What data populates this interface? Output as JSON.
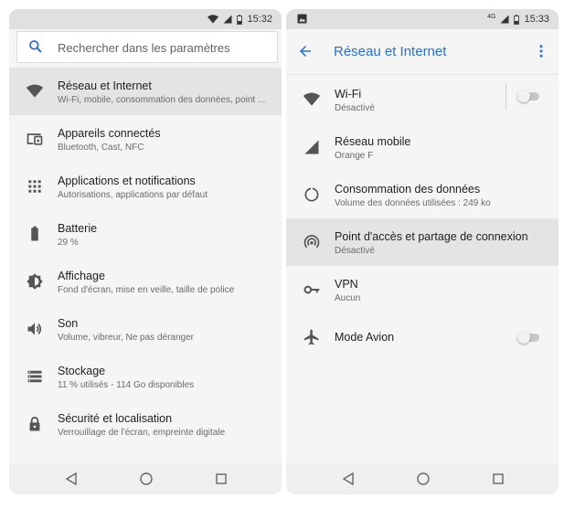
{
  "left_screen": {
    "status": {
      "time": "15:32"
    },
    "search": {
      "placeholder": "Rechercher dans les paramètres",
      "icon": "search-icon"
    },
    "items": [
      {
        "icon": "wifi-icon",
        "title": "Réseau et Internet",
        "subtitle": "Wi-Fi, mobile, consommation des données, point ..."
      },
      {
        "icon": "devices-icon",
        "title": "Appareils connectés",
        "subtitle": "Bluetooth, Cast, NFC"
      },
      {
        "icon": "apps-grid-icon",
        "title": "Applications et notifications",
        "subtitle": "Autorisations, applications par défaut"
      },
      {
        "icon": "battery-icon",
        "title": "Batterie",
        "subtitle": "29 %"
      },
      {
        "icon": "brightness-icon",
        "title": "Affichage",
        "subtitle": "Fond d'écran, mise en veille, taille de police"
      },
      {
        "icon": "volume-icon",
        "title": "Son",
        "subtitle": "Volume, vibreur, Ne pas déranger"
      },
      {
        "icon": "storage-icon",
        "title": "Stockage",
        "subtitle": "11 % utilisés - 114 Go disponibles"
      },
      {
        "icon": "lock-icon",
        "title": "Sécurité et localisation",
        "subtitle": "Verrouillage de l'écran, empreinte digitale"
      }
    ]
  },
  "right_screen": {
    "status": {
      "time": "15:33",
      "network": "4G"
    },
    "header": {
      "title": "Réseau et Internet"
    },
    "items": [
      {
        "icon": "wifi-icon",
        "title": "Wi-Fi",
        "subtitle": "Désactivé",
        "toggle": "off"
      },
      {
        "icon": "cell-signal-icon",
        "title": "Réseau mobile",
        "subtitle": "Orange F"
      },
      {
        "icon": "data-usage-icon",
        "title": "Consommation des données",
        "subtitle": "Volume des données utilisées : 249 ko"
      },
      {
        "icon": "hotspot-icon",
        "title": "Point d'accès et partage de connexion",
        "subtitle": "Désactivé"
      },
      {
        "icon": "vpn-key-icon",
        "title": "VPN",
        "subtitle": "Aucun"
      },
      {
        "icon": "airplane-icon",
        "title": "Mode Avion",
        "toggle": "off"
      }
    ]
  },
  "colors": {
    "accent": "#2b6fca",
    "icon": "#555555",
    "highlight": "#e4e4e4"
  }
}
